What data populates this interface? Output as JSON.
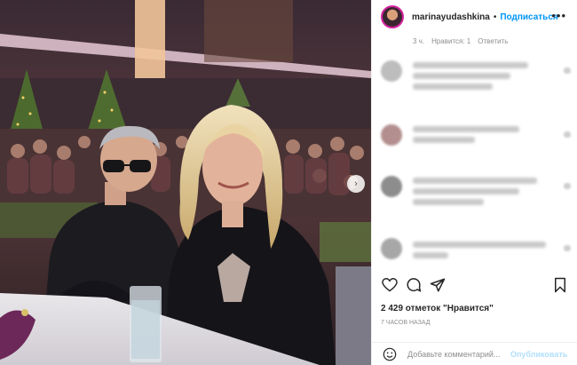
{
  "header": {
    "username": "marinayudashkina",
    "dot": "•",
    "follow_label": "Подписаться",
    "more_icon": "more-horizontal-icon"
  },
  "reply_meta": {
    "time": "3 ч.",
    "likes": "Нравится: 1",
    "reply": "Ответить"
  },
  "comments": [
    {
      "blurred": true
    },
    {
      "blurred": true
    },
    {
      "blurred": true
    },
    {
      "blurred": true
    }
  ],
  "actions": {
    "like_icon": "heart-icon",
    "comment_icon": "comment-bubble-icon",
    "share_icon": "paper-plane-icon",
    "save_icon": "bookmark-icon"
  },
  "likes_text": "2 429 отметок \"Нравится\"",
  "time_ago": "7 часов назад",
  "comment_box": {
    "emoji_icon": "smiley-icon",
    "placeholder": "Добавьте комментарий...",
    "publish_label": "Опубликовать"
  },
  "colors": {
    "accent": "#0095f6",
    "publish_disabled": "#b2dffc",
    "muted_text": "#8e8e8e"
  }
}
